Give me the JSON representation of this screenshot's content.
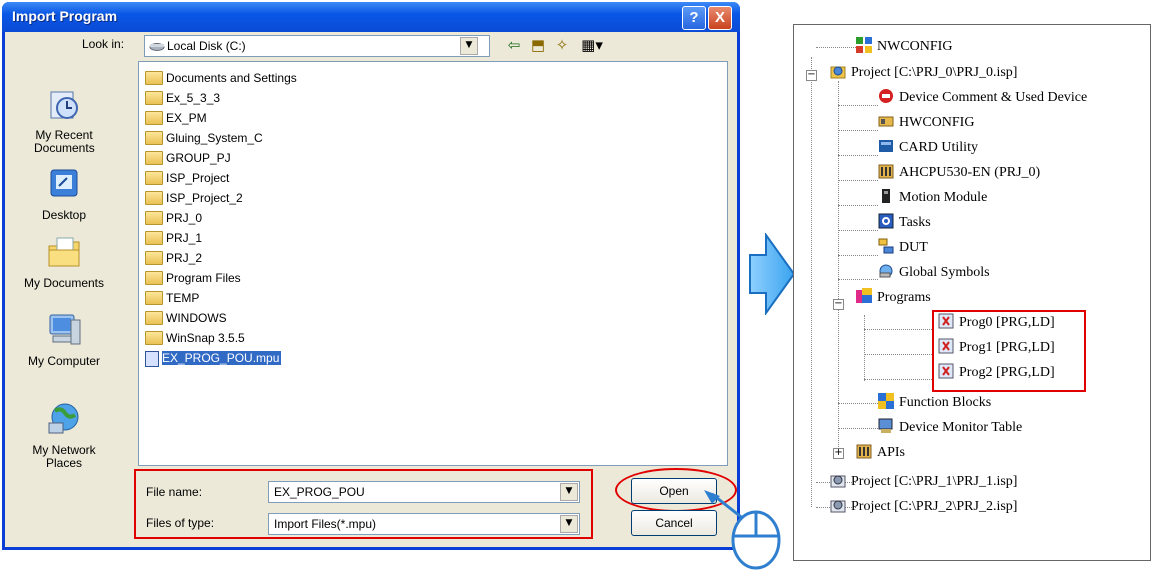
{
  "dialog": {
    "title": "Import Program",
    "help": "?",
    "close": "X",
    "look_in_label": "Look in:",
    "look_in_value": "Local Disk (C:)",
    "places": [
      {
        "label": "My Recent Documents"
      },
      {
        "label": "Desktop"
      },
      {
        "label": "My Documents"
      },
      {
        "label": "My Computer"
      },
      {
        "label": "My Network Places"
      }
    ],
    "files": [
      "Documents and Settings",
      "Ex_5_3_3",
      "EX_PM",
      "Gluing_System_C",
      "GROUP_PJ",
      "ISP_Project",
      "ISP_Project_2",
      "PRJ_0",
      "PRJ_1",
      "PRJ_2",
      "Program Files",
      "TEMP",
      "WINDOWS",
      "WinSnap 3.5.5",
      "EX_PROG_POU.mpu"
    ],
    "file_name_label": "File name:",
    "file_name_value": "EX_PROG_POU",
    "file_type_label": "Files of type:",
    "file_type_value": "Import Files(*.mpu)",
    "open_label": "Open",
    "cancel_label": "Cancel"
  },
  "tree": {
    "items": [
      "NWCONFIG",
      "Project [C:\\PRJ_0\\PRJ_0.isp]",
      "Device Comment & Used Device",
      "HWCONFIG",
      "CARD Utility",
      "AHCPU530-EN  (PRJ_0)",
      "Motion Module",
      "Tasks",
      "DUT",
      "Global Symbols",
      "Programs",
      "Prog0 [PRG,LD]",
      "Prog1 [PRG,LD]",
      "Prog2 [PRG,LD]",
      "Function Blocks",
      "Device Monitor Table",
      "APIs",
      "Project [C:\\PRJ_1\\PRJ_1.isp]",
      "Project [C:\\PRJ_2\\PRJ_2.isp]"
    ]
  },
  "colors": {
    "highlight": "#e00000",
    "arrow": "#39a7f0",
    "titlebar": "#0a57e5"
  }
}
